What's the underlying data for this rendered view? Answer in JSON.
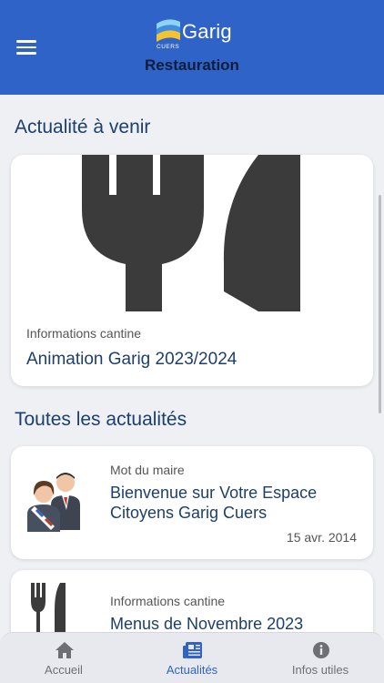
{
  "header": {
    "logo_word": "Garig",
    "logo_sub": "CUERS",
    "title": "Restauration",
    "background": "#2f63c7"
  },
  "upcoming": {
    "section_title": "Actualité à venir",
    "card": {
      "image_icon": "fork-knife-icon",
      "category": "Informations cantine",
      "title": "Animation Garig 2023/2024"
    }
  },
  "all_news": {
    "section_title": "Toutes les actualités",
    "items": [
      {
        "thumbnail_icon": "mayor-couple-icon",
        "category": "Mot du maire",
        "title": "Bienvenue sur Votre Espace Citoyens Garig Cuers",
        "date": "15 avr. 2014"
      },
      {
        "thumbnail_icon": "fork-knife-icon",
        "category": "Informations cantine",
        "title": "Menus de Novembre 2023",
        "date": ""
      }
    ]
  },
  "tabbar": {
    "tabs": [
      {
        "label": "Accueil",
        "icon": "home-icon",
        "active": false
      },
      {
        "label": "Actualités",
        "icon": "news-icon",
        "active": true
      },
      {
        "label": "Infos utiles",
        "icon": "info-icon",
        "active": false
      }
    ],
    "active_color": "#2f63c7",
    "inactive_color": "#6d6f75"
  }
}
